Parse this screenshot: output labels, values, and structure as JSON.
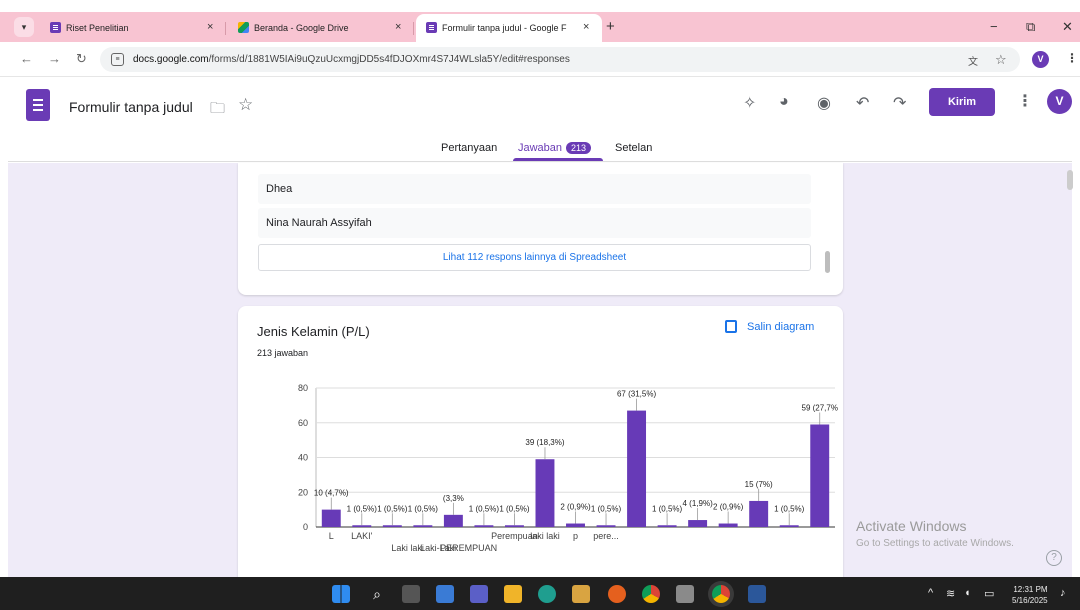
{
  "browser": {
    "tabs": [
      {
        "title": "Riset Penelitian",
        "icon": "forms-icon"
      },
      {
        "title": "Beranda - Google Drive",
        "icon": "drive-icon"
      },
      {
        "title": "Formulir tanpa judul - Google F",
        "icon": "forms-icon"
      }
    ],
    "url_host": "docs.google.com",
    "url_path": "/forms/d/1881W5IAi9uQzuUcxmgjDD5s4fDJOXmr4S7J4WLsla5Y/edit#responses",
    "profile_initial": "V"
  },
  "form": {
    "title": "Formulir tanpa judul",
    "send_label": "Kirim",
    "avatar_initial": "V",
    "tabs": {
      "questions": "Pertanyaan",
      "responses": "Jawaban",
      "settings": "Setelan"
    },
    "responses_badge": "213"
  },
  "responses_list": {
    "names": [
      "Dhea",
      "Nina Naurah Assyifah"
    ],
    "more_link": "Lihat 112 respons lainnya di Spreadsheet"
  },
  "question": {
    "title": "Jenis Kelamin (P/L)",
    "count_text": "213 jawaban",
    "copy_label": "Salin diagram"
  },
  "chart_data": {
    "type": "bar",
    "ylim": [
      0,
      80
    ],
    "yticks": [
      "0",
      "20",
      "40",
      "60",
      "80"
    ],
    "categories": [
      "L",
      "",
      "LAKI'",
      "",
      "",
      "Laki laki",
      "",
      "Laki-Laki",
      "",
      "PEREMPUAN",
      "",
      "",
      "Perempuan",
      "",
      "laki laki",
      "",
      "p",
      "",
      "pere..."
    ],
    "values": [
      10,
      1,
      1,
      1,
      7,
      1,
      1,
      39,
      2,
      1,
      67,
      1,
      4,
      2,
      15,
      1,
      59
    ],
    "labels": [
      "10 (4,7%)",
      "1 (0,5%)",
      "1 (0,5%)",
      "1 (0,5%)",
      "(3,3%",
      "1 (0,5%)",
      "1 (0,5%)",
      "39 (18,3%)",
      "2 (0,9%)",
      "1 (0,5%)",
      "67 (31,5%)",
      "1 (0,5%)",
      "4 (1,9%)",
      "2 (0,9%)",
      "15 (7%)",
      "1 (0,5%)",
      "59 (27,7%"
    ],
    "color": "#673ab7",
    "grid": true
  },
  "windows": {
    "activate_title": "Activate Windows",
    "activate_sub": "Go to Settings to activate Windows."
  },
  "taskbar": {
    "time": "12:31 PM",
    "date": "5/16/2025"
  }
}
